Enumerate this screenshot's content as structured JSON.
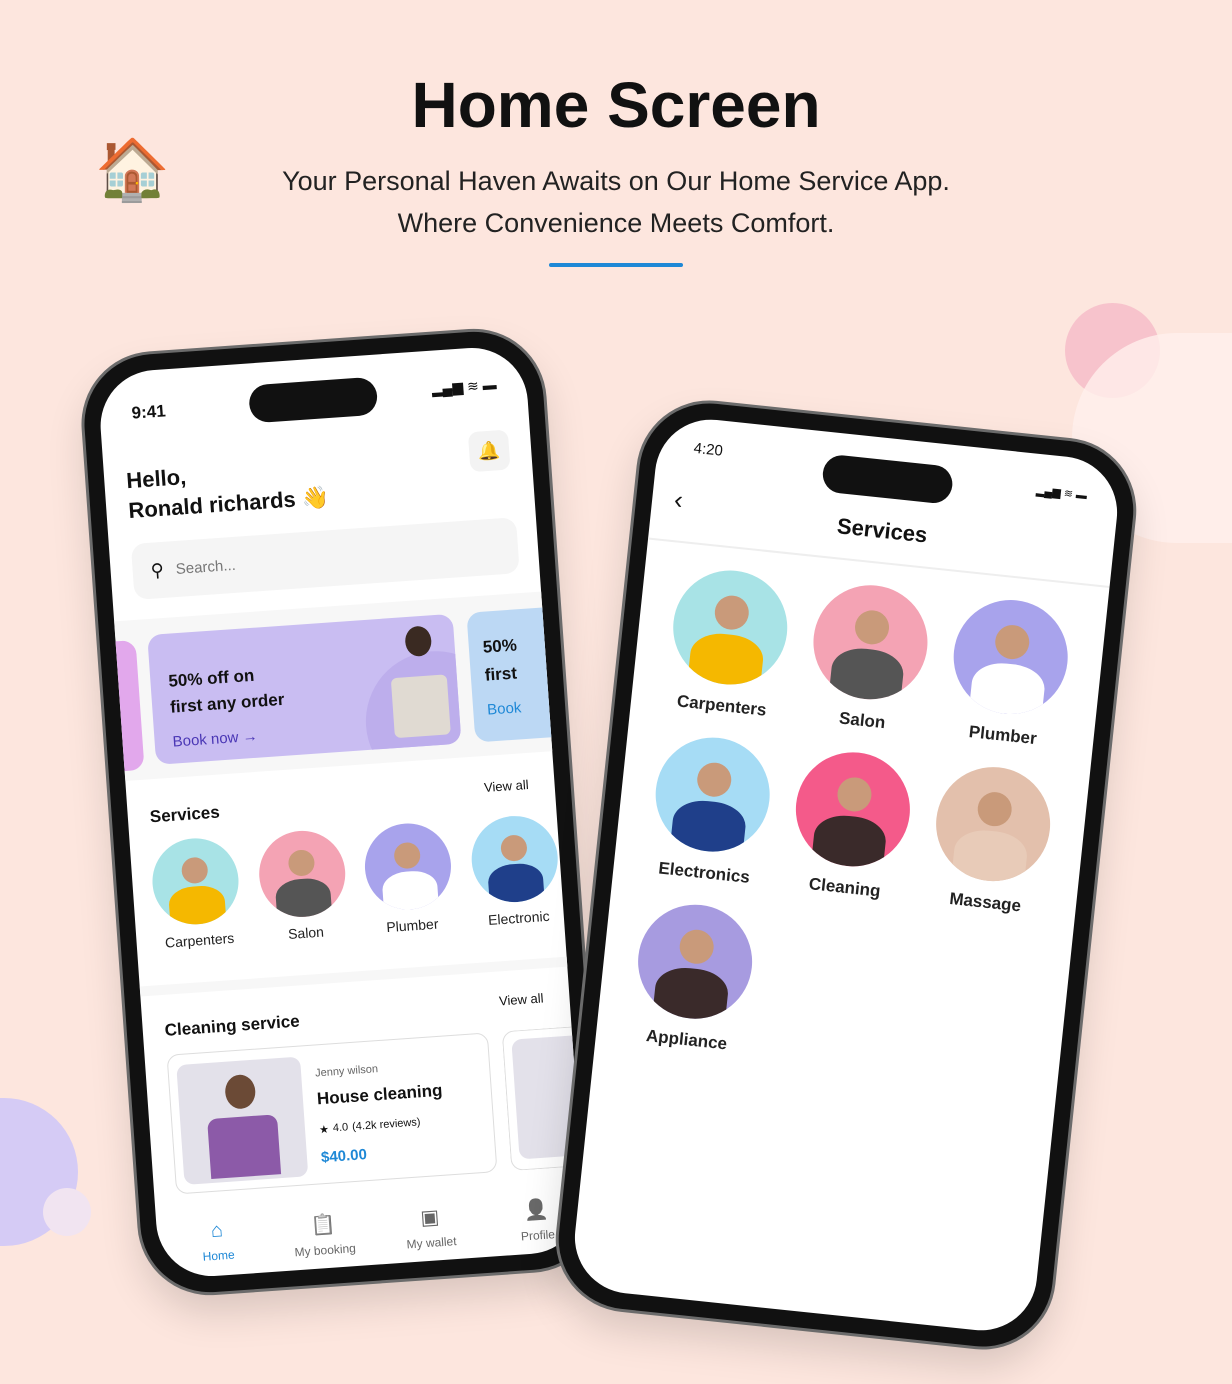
{
  "header": {
    "title": "Home Screen",
    "subtitle_line1": "Your Personal Haven Awaits on Our Home Service App.",
    "subtitle_line2": "Where Convenience Meets Comfort."
  },
  "colors": {
    "background": "#fde6de",
    "accent": "#1e88d6",
    "banner": "#c9bdf2"
  },
  "home": {
    "time": "9:41",
    "greeting": "Hello,",
    "name": "Ronald richards 👋",
    "search_placeholder": "Search...",
    "banner": {
      "line1": "50% off on",
      "line2": "first any order",
      "cta": "Book now →"
    },
    "banner_next": {
      "line1": "50%",
      "line2": "first",
      "cta": "Book"
    },
    "services_title": "Services",
    "view_all": "View all",
    "services": [
      {
        "label": "Carpenters",
        "color": "#a8e3e6",
        "shirt": "#f5b800"
      },
      {
        "label": "Salon",
        "color": "#f4a3b4",
        "shirt": "#555"
      },
      {
        "label": "Plumber",
        "color": "#a8a3ec",
        "shirt": "#fff"
      },
      {
        "label": "Electronic",
        "color": "#a6dcf5",
        "shirt": "#1f3f8a"
      }
    ],
    "cleaning_title": "Cleaning service",
    "cleaning_view_all": "View all",
    "card": {
      "provider": "Jenny wilson",
      "title": "House cleaning",
      "rating": "4.0",
      "reviews": "(4.2k reviews)",
      "price": "$40.00"
    },
    "nav": [
      {
        "label": "Home",
        "icon": "home-icon",
        "active": true
      },
      {
        "label": "My booking",
        "icon": "clipboard-icon"
      },
      {
        "label": "My wallet",
        "icon": "wallet-icon"
      },
      {
        "label": "Profile",
        "icon": "user-icon"
      }
    ]
  },
  "services_screen": {
    "time": "4:20",
    "title": "Services",
    "items": [
      {
        "label": "Carpenters",
        "color": "#a8e3e6",
        "shirt": "#f5b800"
      },
      {
        "label": "Salon",
        "color": "#f4a3b4",
        "shirt": "#555"
      },
      {
        "label": "Plumber",
        "color": "#a8a3ec",
        "shirt": "#fff"
      },
      {
        "label": "Electronics",
        "color": "#a6dcf5",
        "shirt": "#1f3f8a"
      },
      {
        "label": "Cleaning",
        "color": "#f45a8a",
        "shirt": "#3a2a2a"
      },
      {
        "label": "Massage",
        "color": "#e3c0ac",
        "shirt": "#e8cbb8"
      },
      {
        "label": "Appliance",
        "color": "#a79be0",
        "shirt": "#3a2a2a"
      }
    ]
  }
}
